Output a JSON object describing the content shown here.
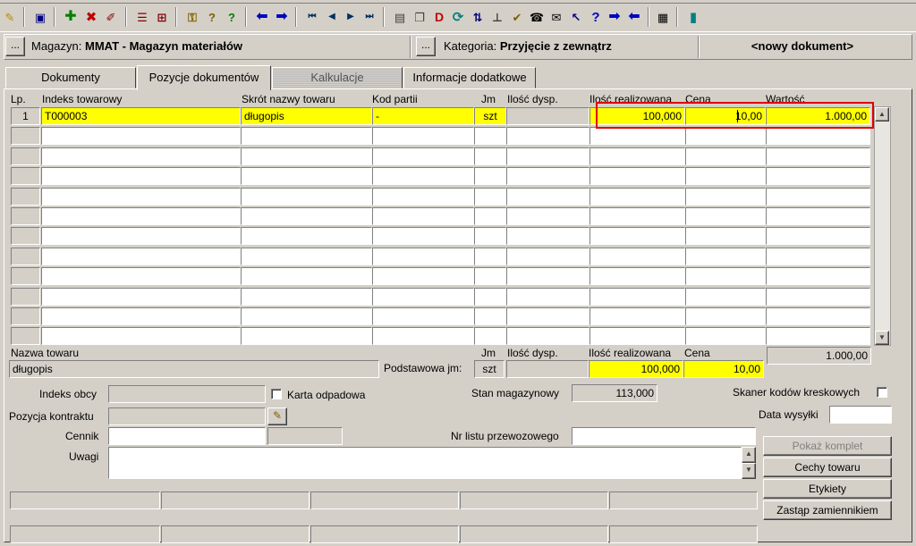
{
  "toolbar": {
    "icons": [
      "pin-icon",
      "save-icon",
      "add-icon",
      "delete-icon",
      "edit-icon",
      "split-icon",
      "split2-icon",
      "help1-icon",
      "help2-icon",
      "help3-icon",
      "arrow-left-icon",
      "arrow-right-icon",
      "first-icon",
      "prev-icon",
      "next-icon",
      "last-icon",
      "document-icon",
      "copy-icon",
      "d-icon",
      "refresh-icon",
      "sort-icon",
      "tree-icon",
      "check-icon",
      "phone-icon",
      "mail-icon",
      "pointer-icon",
      "question-icon",
      "forward-icon",
      "back-icon",
      "calculator-icon",
      "exit-icon"
    ]
  },
  "header": {
    "magazyn_label": "Magazyn:",
    "magazyn_value": "MMAT - Magazyn materiałów",
    "kategoria_label": "Kategoria:",
    "kategoria_value": "Przyjęcie z zewnątrz",
    "status": "<nowy dokument>",
    "ellipsis": "..."
  },
  "tabs": [
    "Dokumenty",
    "Pozycje dokumentów",
    "Kalkulacje",
    "Informacje dodatkowe"
  ],
  "grid": {
    "headers": [
      "Lp.",
      "Indeks towarowy",
      "Skrót nazwy towaru",
      "Kod partii",
      "Jm",
      "Ilość dysp.",
      "Ilość realizowana",
      "Cena",
      "Wartość"
    ],
    "row1": {
      "lp": "1",
      "indeks": "T000003",
      "skrot": "długopis",
      "kod_partii": "-",
      "jm": "szt",
      "ilosc_dysp": "",
      "ilosc_real": "100,000",
      "cena": "10,00",
      "wartosc": "1.000,00"
    }
  },
  "details": {
    "nazwa_label": "Nazwa towaru",
    "nazwa_value": "długopis",
    "podstawowa_label": "Podstawowa jm:",
    "jm_label": "Jm",
    "jm_value": "szt",
    "ilosc_dysp_label": "Ilość dysp.",
    "ilosc_real_label": "Ilość realizowana",
    "ilosc_real_value": "100,000",
    "cena_label": "Cena",
    "cena_value": "10,00",
    "total_value": "1.000,00",
    "indeks_obcy_label": "Indeks obcy",
    "karta_label": "Karta odpadowa",
    "stan_label": "Stan magazynowy",
    "stan_value": "113,000",
    "skaner_label": "Skaner kodów kreskowych",
    "pozycja_label": "Pozycja kontraktu",
    "data_wysylki_label": "Data wysyłki",
    "cennik_label": "Cennik",
    "nr_listu_label": "Nr listu przewozowego",
    "uwagi_label": "Uwagi"
  },
  "buttons": {
    "pokaz": "Pokaż komplet",
    "cechy": "Cechy towaru",
    "etykiety": "Etykiety",
    "zastap": "Zastąp zamiennikiem"
  }
}
